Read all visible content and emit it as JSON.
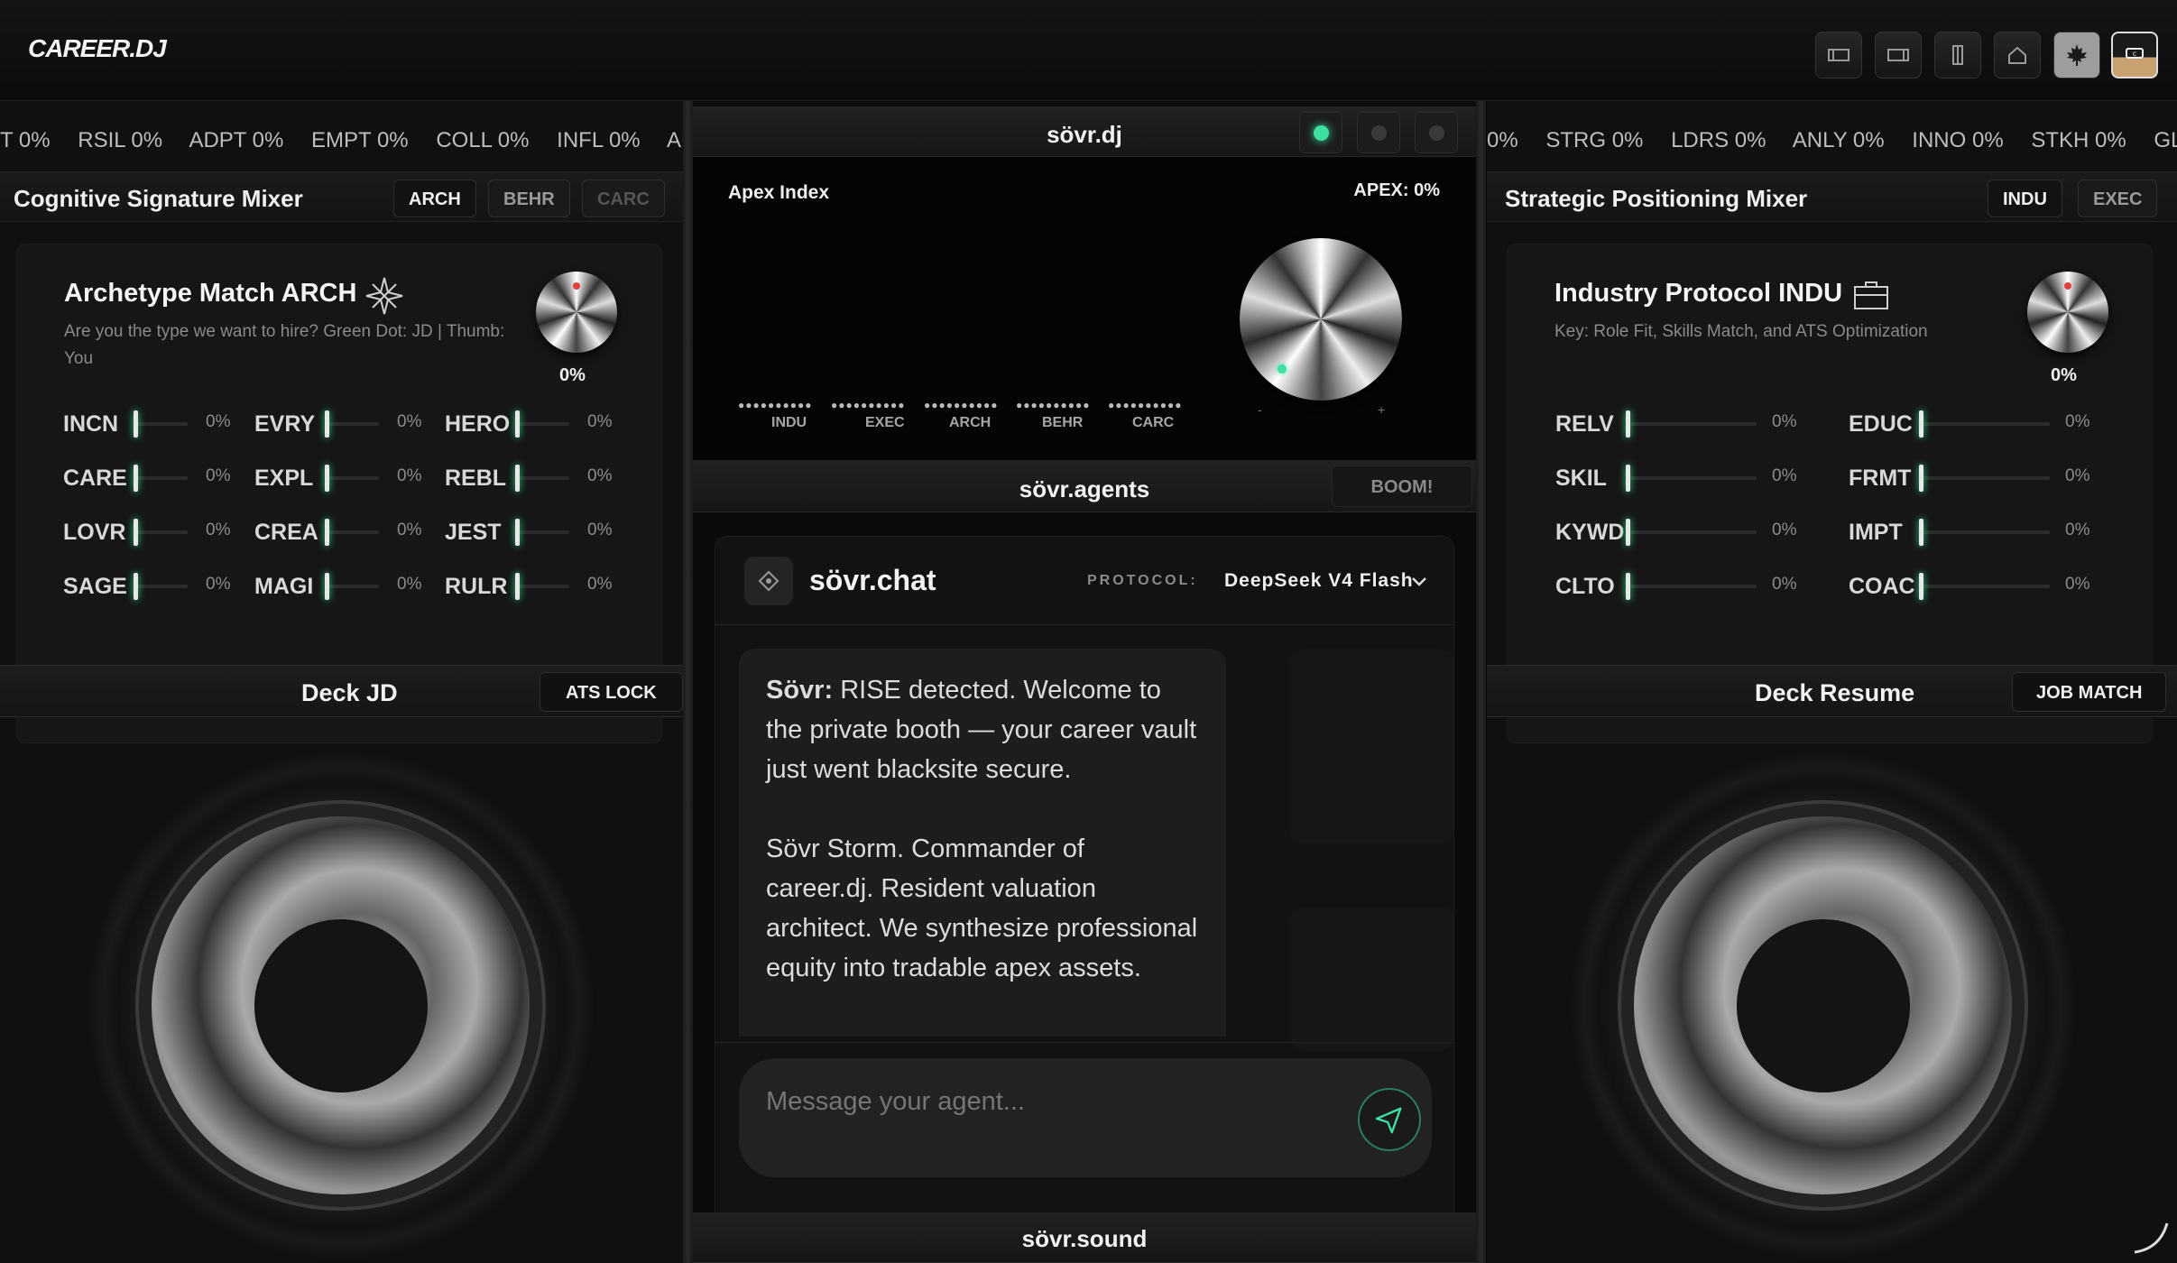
{
  "app": {
    "logo": "CAREER.DJ"
  },
  "left": {
    "ticker": [
      "T 0%",
      "RSIL 0%",
      "ADPT 0%",
      "EMPT 0%",
      "COLL 0%",
      "INFL 0%",
      "ANLT"
    ],
    "mixer_title": "Cognitive Signature Mixer",
    "tabs": [
      "ARCH",
      "BEHR",
      "CARC"
    ],
    "card": {
      "title": "Archetype Match ARCH",
      "subtitle_1": "Are you the type we want to hire? Green Dot: JD | Thumb:",
      "subtitle_2": "You",
      "knob_value": "0%"
    },
    "faders": [
      {
        "label": "INCN",
        "value": "0%"
      },
      {
        "label": "EVRY",
        "value": "0%"
      },
      {
        "label": "HERO",
        "value": "0%"
      },
      {
        "label": "CARE",
        "value": "0%"
      },
      {
        "label": "EXPL",
        "value": "0%"
      },
      {
        "label": "REBL",
        "value": "0%"
      },
      {
        "label": "LOVR",
        "value": "0%"
      },
      {
        "label": "CREA",
        "value": "0%"
      },
      {
        "label": "JEST",
        "value": "0%"
      },
      {
        "label": "SAGE",
        "value": "0%"
      },
      {
        "label": "MAGI",
        "value": "0%"
      },
      {
        "label": "RULR",
        "value": "0%"
      }
    ],
    "deck_title": "Deck JD",
    "deck_button": "ATS LOCK"
  },
  "center": {
    "header_title": "sövr.dj",
    "apex_label": "Apex Index",
    "apex_value": "APEX: 0%",
    "knob_minus": "-",
    "knob_plus": "+",
    "meters": [
      "INDU",
      "EXEC",
      "ARCH",
      "BEHR",
      "CARC"
    ],
    "agents_title": "sövr.agents",
    "boom_button": "BOOM!",
    "chat": {
      "title": "sövr.chat",
      "protocol_label": "PROTOCOL:",
      "protocol_value": "DeepSeek V4 Flash",
      "msg_sender": "Sövr:",
      "msg_p1": "RISE detected. Welcome to the private booth — your career vault just went blacksite secure.",
      "msg_p2": "Sövr Storm. Commander of career.dj. Resident valuation architect. We synthesize professional equity into tradable apex assets.",
      "input_placeholder": "Message your agent..."
    },
    "sound_title": "sövr.sound"
  },
  "right": {
    "ticker": [
      "0%",
      "STRG 0%",
      "LDRS 0%",
      "ANLY 0%",
      "INNO 0%",
      "STKH 0%",
      "GLOB"
    ],
    "mixer_title": "Strategic Positioning Mixer",
    "tabs": [
      "INDU",
      "EXEC"
    ],
    "card": {
      "title": "Industry Protocol INDU",
      "subtitle": "Key: Role Fit, Skills Match, and ATS Optimization",
      "knob_value": "0%"
    },
    "faders": [
      {
        "label": "RELV",
        "value": "0%"
      },
      {
        "label": "EDUC",
        "value": "0%"
      },
      {
        "label": "SKIL",
        "value": "0%"
      },
      {
        "label": "FRMT",
        "value": "0%"
      },
      {
        "label": "KYWD",
        "value": "0%"
      },
      {
        "label": "IMPT",
        "value": "0%"
      },
      {
        "label": "CLTO",
        "value": "0%"
      },
      {
        "label": "COAC",
        "value": "0%"
      }
    ],
    "deck_title": "Deck Resume",
    "deck_button": "JOB MATCH"
  },
  "colors": {
    "accent": "#3de0a0",
    "knob_indicator": "#e04040",
    "background": "#0a0a0a"
  },
  "icons": [
    "layout-left-icon",
    "layout-right-icon",
    "layout-split-icon",
    "home-icon",
    "maple-leaf-icon",
    "profile-icon",
    "compass-icon",
    "chevron-down-icon",
    "send-icon",
    "sparkle-icon",
    "briefcase-icon"
  ]
}
